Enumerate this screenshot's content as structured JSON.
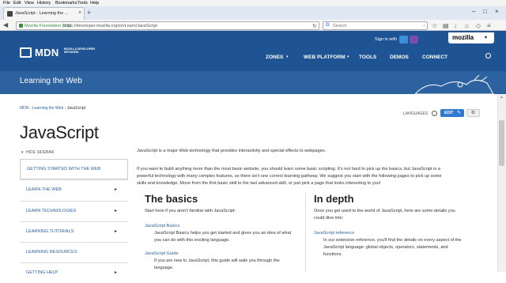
{
  "menubar": [
    "File",
    "Edit",
    "View",
    "History",
    "Bookmarks",
    "Tools",
    "Help"
  ],
  "tab": {
    "title": "JavaScript - Learning the ..."
  },
  "urlbar": {
    "org": "Mozilla Foundation (US)",
    "url": "https://developer.mozilla.org/en/Learn/JavaScript"
  },
  "searchbar": {
    "placeholder": "Search"
  },
  "header": {
    "signin": "Sign in with",
    "mozilla": "mozilla",
    "logo": "MDN",
    "logo_sub": "MOZILLA DEVELOPER NETWORK",
    "nav": [
      "ZONES",
      "WEB PLATFORM",
      "TOOLS",
      "DEMOS",
      "CONNECT"
    ],
    "section_title": "Learning the Web"
  },
  "breadcrumb": {
    "items": [
      "MDN",
      "Learning the Web",
      "JavaScript"
    ],
    "sep": "›"
  },
  "tools": {
    "languages": "LANGUAGES",
    "edit": "EDIT"
  },
  "page_title": "JavaScript",
  "sidebar": {
    "hide": "HIDE SIDEBAR",
    "items": [
      {
        "label": "GETTING STARTED WITH THE WEB",
        "chevron": ""
      },
      {
        "label": "LEARN THE WEB",
        "chevron": "▸"
      },
      {
        "label": "LEARN TECHNOLOGIES",
        "chevron": "▸"
      },
      {
        "label": "LEARNING TUTORIALS",
        "chevron": "▸"
      },
      {
        "label": "LEARNING RESOURCES",
        "chevron": ""
      },
      {
        "label": "GETTING HELP",
        "chevron": "▸"
      }
    ]
  },
  "content": {
    "intro": "JavaScript is a major Web technology that provides interactivity and special effects to webpages.",
    "para2_l1": "If you want to build anything more than the most basic website, you should learn some basic scripting. It's not hard to pick up the basics, but JavaScript is a",
    "para2_l2": "powerful technology with many complex features, so there isn't one correct learning pathway. We suggest you start with the following pages to pick up some",
    "para2_l3": "skills and knowledge. Move from the first basic skill to the last advanced skill, or just pick a page that looks interesting to you!",
    "basics": {
      "heading": "The basics",
      "lead": "Start here if you aren't familiar with JavaScript:",
      "link1": "JavaScript Basics",
      "desc1_l1": "JavaScript Basics helps you get started and gives you an idea of what",
      "desc1_l2": "you can do with this exciting language.",
      "link2": "JavaScript Guide",
      "desc2_l1": "If you are new to JavaScript, this guide will walk you through the",
      "desc2_l2": "language."
    },
    "depth": {
      "heading": "In depth",
      "lead": "Once you get used to the world of JavaScript, here are some details you",
      "lead2": "could dive into:",
      "link1": "JavaScript reference",
      "desc1_l1": "In our extensive reference, you'll find the details on every aspect of the",
      "desc1_l2": "JavaScript language: global objects, operators, statements, and",
      "desc1_l3": "functions."
    }
  },
  "colors": {
    "header_blue": "#2d62a0",
    "nav_blue": "#1f5494",
    "link": "#2d62a0",
    "edit_button": "#2f7ad0"
  }
}
